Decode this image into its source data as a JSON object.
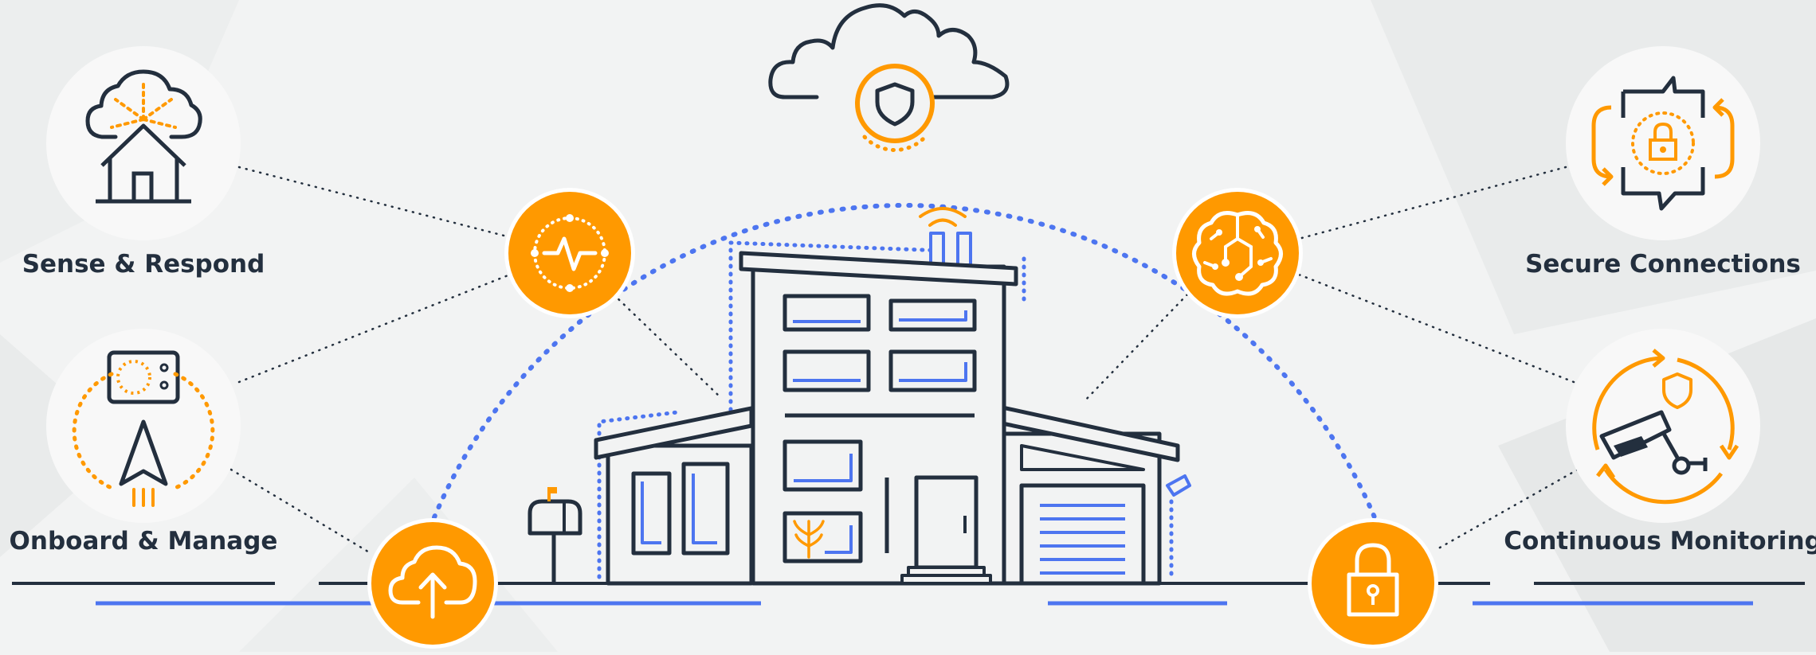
{
  "labels": {
    "sense_respond": "Sense & Respond",
    "onboard_manage": "Onboard & Manage",
    "secure_connections": "Secure Connections",
    "continuous_monitoring": "Continuous Monitoring"
  },
  "icons": {
    "top": "cloud-shield-icon",
    "left_upper": "pulse-icon",
    "left_lower": "cloud-upload-icon",
    "right_upper": "brain-circuit-icon",
    "right_lower": "padlock-icon",
    "sense_respond": "house-cloud-icon",
    "onboard_manage": "thermostat-pointer-icon",
    "secure_connections": "chat-lock-icon",
    "continuous_monitoring": "camera-shield-icon",
    "center": "smart-house-icon"
  },
  "colors": {
    "orange": "#ff9900",
    "navy": "#232f3e",
    "blue": "#4d75f0",
    "background": "#f2f3f3",
    "white": "#ffffff"
  }
}
